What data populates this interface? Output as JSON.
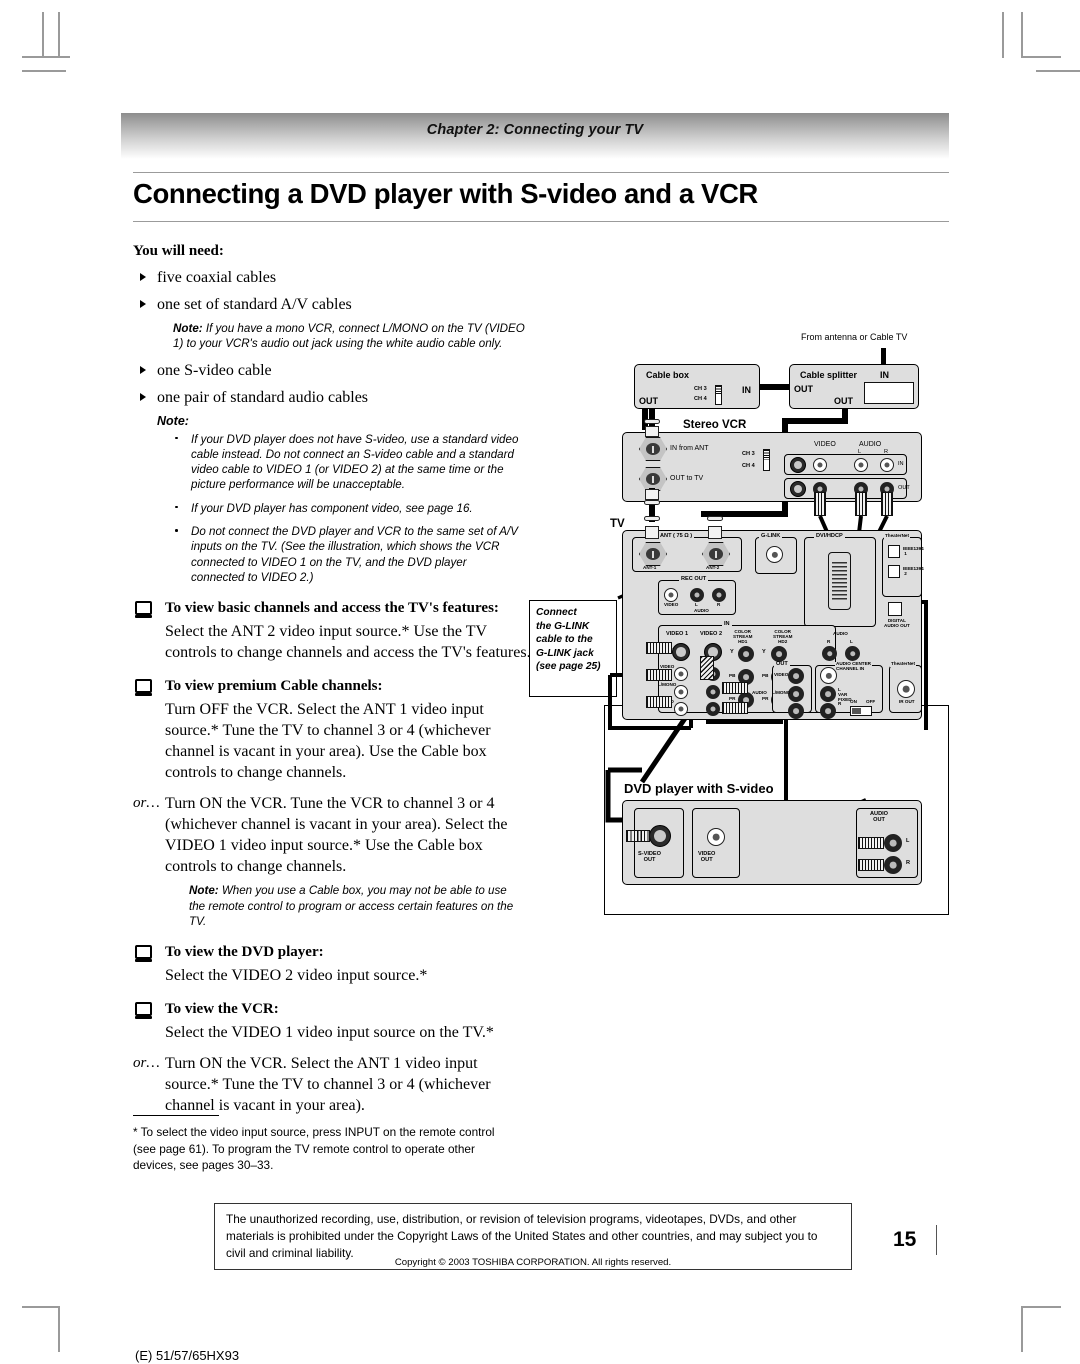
{
  "header": {
    "chapter": "Chapter 2: Connecting your TV",
    "title": "Connecting a DVD player with S-video and a VCR"
  },
  "needs": {
    "heading": "You will need:",
    "items": [
      "five coaxial cables",
      "one set of standard A/V cables",
      "one S-video cable",
      "one pair of standard audio cables"
    ],
    "av_note_label": "Note:",
    "av_note_text": " If you have a mono VCR, connect L/MONO on the TV (VIDEO 1) to your VCR's audio out jack using the white audio cable only.",
    "note_heading": "Note:",
    "note_bullets": [
      "If your DVD player does not have S-video, use a standard video cable instead. Do not connect an S-video cable and a standard video cable to VIDEO 1 (or VIDEO 2) at the same time or the picture performance will be unacceptable.",
      "If your DVD player has component video, see page 16.",
      "Do not connect the DVD player and VCR to the same set of A/V inputs on the TV. (See the illustration, which shows the VCR connected to VIDEO 1 on the TV, and the DVD player connected to VIDEO 2.)"
    ]
  },
  "sections": [
    {
      "heading": "To view basic channels and access the TV's features:",
      "body": "Select the ANT 2 video input source.* Use the TV controls to change channels and access the TV's features."
    },
    {
      "heading": "To view premium Cable channels:",
      "body": "Turn OFF the VCR. Select the ANT 1 video input source.* Tune the TV to channel 3 or 4 (whichever channel is vacant in your area). Use the Cable box controls to change channels.",
      "or_label": "or…",
      "or_body": "Turn ON the VCR. Tune the VCR to channel 3 or 4 (whichever channel is vacant in your area). Select the VIDEO 1 video input source.* Use the Cable box controls to change channels.",
      "note_label": "Note:",
      "note_text": " When you use a Cable box, you may not be able to use the remote control to program or access certain features on the TV."
    },
    {
      "heading": "To view the DVD player:",
      "body": "Select the VIDEO 2 video input source.*"
    },
    {
      "heading": "To view the VCR:",
      "body": "Select the VIDEO 1 video input source on the TV.*",
      "or_label": "or…",
      "or_body": "Turn ON the VCR. Select the ANT 1 video input source.* Tune the TV to channel 3 or 4 (whichever channel is vacant in your area)."
    }
  ],
  "footnote": {
    "line1": "* To select the video input source, press INPUT on the remote control",
    "line2": "(see page 61). To program the TV remote control to operate other",
    "line3": "devices, see pages 30–33."
  },
  "copyright_box": "The unauthorized recording, use, distribution, or revision of television programs, videotapes, DVDs, and other materials is prohibited under the Copyright Laws of the United States and other countries, and may subject you to civil and criminal liability.",
  "copyright_line": "Copyright © 2003 TOSHIBA CORPORATION. All rights reserved.",
  "page_number": "15",
  "footer_code": "(E) 51/57/65HX93",
  "callout": {
    "line1": "Connect",
    "line2": "the G-LINK",
    "line3": "cable to the",
    "line4": "G-LINK jack",
    "line5": "(see page 25)"
  },
  "diagram": {
    "antenna_source": "From antenna or Cable TV",
    "cable_box": {
      "title": "Cable box",
      "in": "IN",
      "out": "OUT",
      "ch3": "CH 3",
      "ch4": "CH 4"
    },
    "cable_splitter": {
      "title": "Cable splitter",
      "in": "IN",
      "out1": "OUT",
      "out2": "OUT"
    },
    "vcr": {
      "title": "Stereo VCR",
      "in_from_ant": "IN from ANT",
      "out_to_tv": "OUT to TV",
      "ch3": "CH 3",
      "ch4": "CH 4",
      "video": "VIDEO",
      "audio": "AUDIO",
      "l": "L",
      "r": "R",
      "in": "IN",
      "out": "OUT"
    },
    "tv": {
      "title": "TV",
      "ant_group": "ANT ( 75 Ω )",
      "ant1": "ANT-1",
      "ant2": "ANT-2",
      "glink": "G-LINK",
      "dvi": "DVI/HDCP",
      "theaternet": "TheaterNet",
      "ieee1394_1": "IEEE1394\n1",
      "ieee1394_2": "IEEE1394\n2",
      "digital_audio_out": "DIGITAL\nAUDIO OUT",
      "rec_out": "REC OUT",
      "video": "VIDEO",
      "audio": "AUDIO",
      "l": "L",
      "r": "R",
      "in": "IN",
      "out": "OUT",
      "video1": "VIDEO 1",
      "video2": "VIDEO 2",
      "svideo": "S-VIDEO",
      "colorstream1": "COLOR\nSTREAM\nHD1",
      "colorstream2": "COLOR\nSTREAM\nHD2",
      "y": "Y",
      "pb": "PB",
      "pr": "PR",
      "mono": "L/MONO",
      "audio_center": "AUDIO CENTER\nCHANNEL IN",
      "var_fixed": "VAR\nFIXED",
      "on": "ON",
      "off": "OFF",
      "ir_out": "IR OUT"
    },
    "dvd": {
      "title": "DVD player with S-video",
      "svideo_out": "S-VIDEO\nOUT",
      "video_out": "VIDEO\nOUT",
      "audio_out": "AUDIO\nOUT",
      "l": "L",
      "r": "R"
    }
  }
}
